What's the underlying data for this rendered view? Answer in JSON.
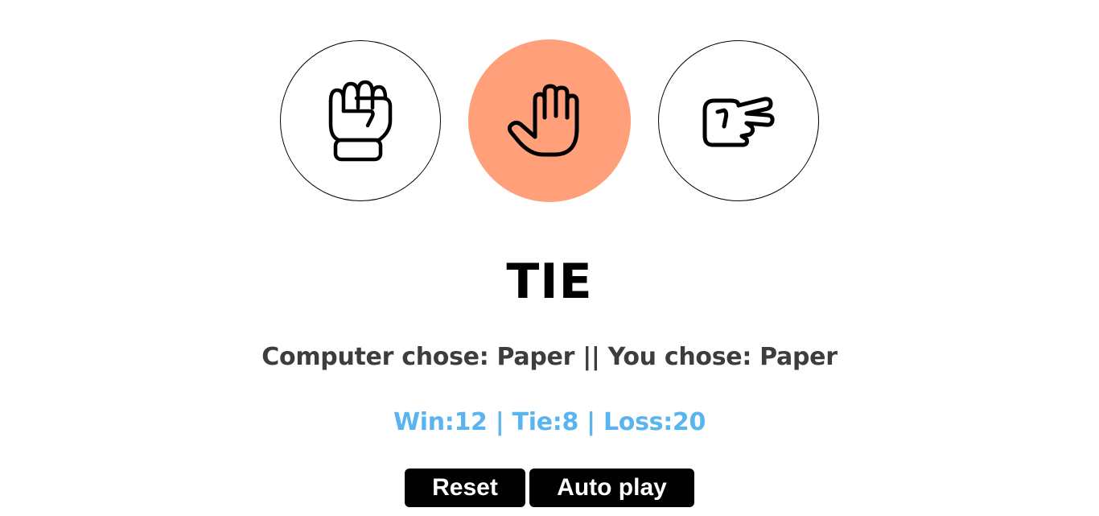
{
  "choices": [
    {
      "name": "Rock",
      "icon": "fist-icon",
      "selected": false
    },
    {
      "name": "Paper",
      "icon": "open-hand-icon",
      "selected": true
    },
    {
      "name": "Scissors",
      "icon": "scissors-hand-icon",
      "selected": false
    }
  ],
  "result": "TIE",
  "moves_text": "Computer chose: Paper || You chose: Paper",
  "score_text": "Win:12 | Tie:8 | Loss:20",
  "score": {
    "wins": 12,
    "ties": 8,
    "losses": 20
  },
  "buttons": {
    "reset_label": "Reset",
    "autoplay_label": "Auto play"
  },
  "colors": {
    "selected_bg": "#ffa07a",
    "score_text": "#5ab4ef",
    "result_text": "#000000",
    "moves_text": "#3d3d3d",
    "button_bg": "#000000",
    "button_text": "#ffffff"
  }
}
